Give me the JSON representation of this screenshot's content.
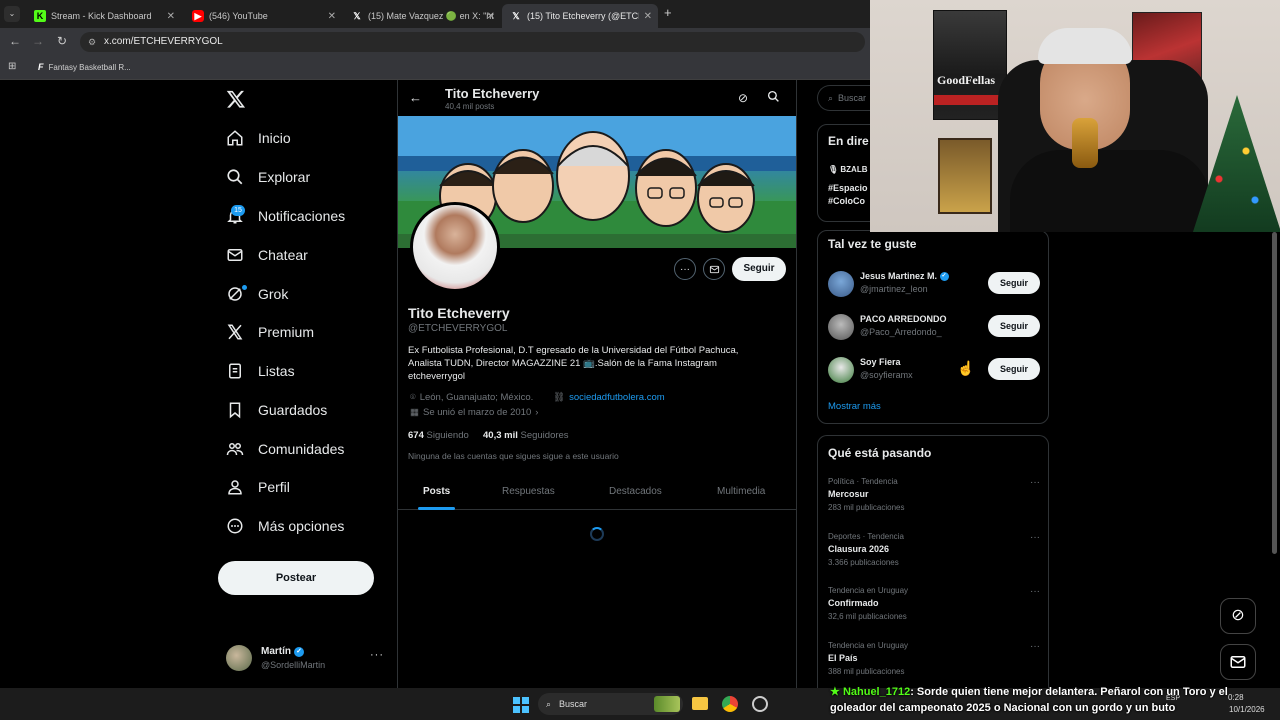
{
  "browser": {
    "tabs": [
      {
        "label": "Stream - Kick Dashboard",
        "icon": "kick-icon"
      },
      {
        "label": "(546) YouTube",
        "icon": "youtube-icon"
      },
      {
        "label": "(15) Mate Vazquez 🟢 en X: \"ht",
        "icon": "x-icon"
      },
      {
        "label": "(15) Tito Etcheverry (@ETCHEVE",
        "icon": "x-icon"
      }
    ],
    "url": "x.com/ETCHEVERRYGOL",
    "bookmark": "Fantasy Basketball R..."
  },
  "nav": {
    "items": [
      {
        "label": "Inicio",
        "icon": "home-icon"
      },
      {
        "label": "Explorar",
        "icon": "search-icon"
      },
      {
        "label": "Notificaciones",
        "icon": "bell-icon"
      },
      {
        "label": "Chatear",
        "icon": "mail-icon"
      },
      {
        "label": "Grok",
        "icon": "grok-icon"
      },
      {
        "label": "Premium",
        "icon": "x-premium-icon"
      },
      {
        "label": "Listas",
        "icon": "list-icon"
      },
      {
        "label": "Guardados",
        "icon": "bookmark-icon"
      },
      {
        "label": "Comunidades",
        "icon": "communities-icon"
      },
      {
        "label": "Perfil",
        "icon": "person-icon"
      },
      {
        "label": "Más opciones",
        "icon": "more-circle-icon"
      }
    ],
    "notifications_badge": "15",
    "post_button": "Postear",
    "account": {
      "name": "Martín",
      "handle": "@SordelliMartin"
    }
  },
  "profile": {
    "header_name": "Tito Etcheverry",
    "post_count": "40,4 mil posts",
    "name": "Tito Etcheverry",
    "handle": "@ETCHEVERRYGOL",
    "bio": "Ex Futbolista Profesional, D.T egresado de la Universidad del Fútbol Pachuca, Analista  TUDN, Director MAGAZZINE 21 📺.Salón de la Fama Instagram etcheverrygol",
    "location": "León, Guanajuato; México.",
    "website": "sociedadfutbolera.com",
    "joined": "Se unió el marzo de 2010",
    "following_count": "674",
    "following_label": "Siguiendo",
    "followers_count": "40,3 mil",
    "followers_label": "Seguidores",
    "followed_by": "Ninguna de las cuentas que sigues sigue a este usuario",
    "follow_button": "Seguir",
    "tabs": [
      "Posts",
      "Respuestas",
      "Destacados",
      "Multimedia"
    ]
  },
  "right": {
    "search_placeholder": "Buscar",
    "live_title": "En dire",
    "live_lines": [
      "BZALB",
      "#Espacio",
      "#ColoCo"
    ],
    "wtf_title": "Tal vez te guste",
    "who_to_follow": [
      {
        "name": "Jesus Martinez M.",
        "handle": "@jmartinez_leon",
        "verified": true
      },
      {
        "name": "PACO ARREDONDO",
        "handle": "@Paco_Arredondo_",
        "verified": false
      },
      {
        "name": "Soy Fiera",
        "handle": "@soyfieramx",
        "verified": false
      }
    ],
    "follow_label": "Seguir",
    "show_more": "Mostrar más",
    "trends_title": "Qué está pasando",
    "trends": [
      {
        "category": "Política · Tendencia",
        "name": "Mercosur",
        "count": "283 mil publicaciones"
      },
      {
        "category": "Deportes · Tendencia",
        "name": "Clausura 2026",
        "count": "3.366 publicaciones"
      },
      {
        "category": "Tendencia en Uruguay",
        "name": "Confirmado",
        "count": "32,6 mil publicaciones"
      },
      {
        "category": "Tendencia en Uruguay",
        "name": "El País",
        "count": "388 mil publicaciones"
      }
    ]
  },
  "stream": {
    "chat_user": "Nahuel_1712",
    "chat_message": ": Sorde quien tiene mejor delantera. Peñarol con un Toro y el goleador del campeonato 2025 o Nacional con un gordo y un buto",
    "poster_text": "GoodFellas"
  },
  "taskbar": {
    "search": "Buscar",
    "lang": "ESP",
    "time": "0:28",
    "date": "10/1/2026"
  },
  "colors": {
    "accent": "#1d9bf0",
    "background": "#000000",
    "border": "#2f3336",
    "muted": "#71767b"
  }
}
